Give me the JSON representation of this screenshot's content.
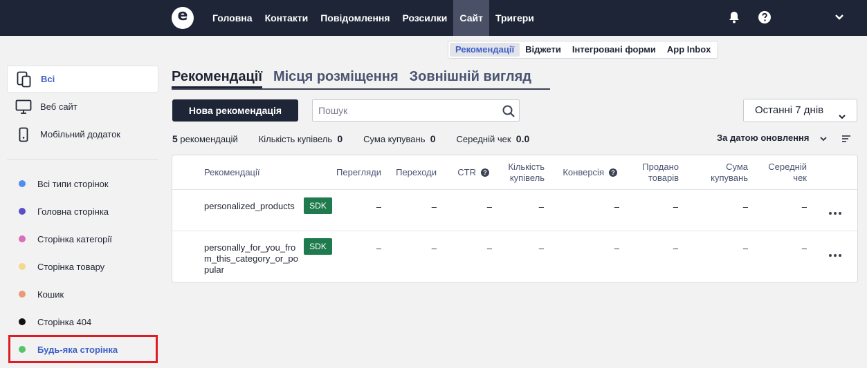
{
  "topnav": {
    "items": [
      "Головна",
      "Контакти",
      "Повідомлення",
      "Розсилки",
      "Сайт",
      "Тригери"
    ],
    "active_index": 4
  },
  "subnav": {
    "items": [
      "Рекомендації",
      "Віджети",
      "Інтегровані форми",
      "App Inbox"
    ],
    "active_index": 0
  },
  "sidebar": {
    "channels": [
      {
        "label": "Всі",
        "icon": "devices-icon",
        "active": true
      },
      {
        "label": "Веб сайт",
        "icon": "monitor-icon",
        "active": false
      },
      {
        "label": "Мобільний додаток",
        "icon": "phone-icon",
        "active": false
      }
    ],
    "page_types": [
      {
        "label": "Всі типи сторінок",
        "color": "#4f8df0"
      },
      {
        "label": "Головна сторінка",
        "color": "#5b4fc8"
      },
      {
        "label": "Сторінка категорії",
        "color": "#d96fb8"
      },
      {
        "label": "Сторінка товару",
        "color": "#f3d88e"
      },
      {
        "label": "Кошик",
        "color": "#ea9a78"
      },
      {
        "label": "Сторінка 404",
        "color": "#111111"
      },
      {
        "label": "Будь-яка сторінка",
        "color": "#55c46a",
        "highlighted": true
      }
    ]
  },
  "main": {
    "tabs": [
      "Рекомендації",
      "Місця розміщення",
      "Зовнішній вигляд"
    ],
    "new_button": "Нова рекомендація",
    "search_placeholder": "Пошук",
    "period": "Останні 7 днів",
    "stats": {
      "count": "5",
      "count_label": "рекомендацій",
      "buyers_label": "Кількість купівель",
      "buyers": "0",
      "sum_label": "Сума купувань",
      "sum": "0",
      "avg_label": "Середній чек",
      "avg": "0.0"
    },
    "sort_label": "За датою оновлення"
  },
  "table": {
    "headers": {
      "name": "Рекомендації",
      "views": "Перегляди",
      "clicks": "Переходи",
      "ctr": "CTR",
      "purchases_1": "Кількість",
      "purchases_2": "купівель",
      "conversion": "Конверсія",
      "sold_1": "Продано",
      "sold_2": "товарів",
      "sum_1": "Сума",
      "sum_2": "купувань",
      "avg_1": "Середній",
      "avg_2": "чек"
    },
    "rows": [
      {
        "name": "personalized_products",
        "badge": "SDK",
        "views": "–",
        "clicks": "–",
        "ctr": "–",
        "purchases": "–",
        "conversion": "–",
        "sold": "–",
        "sum": "–",
        "avg": "–"
      },
      {
        "name": "personally_for_you_from_this_category_or_popular",
        "badge": "SDK",
        "views": "–",
        "clicks": "–",
        "ctr": "–",
        "purchases": "–",
        "conversion": "–",
        "sold": "–",
        "sum": "–",
        "avg": "–"
      }
    ]
  },
  "colors": {
    "topbar": "#1e2536",
    "accent": "#3d5fc7",
    "sdk_badge": "#1f7a4d",
    "highlight_box": "#e01b24"
  }
}
